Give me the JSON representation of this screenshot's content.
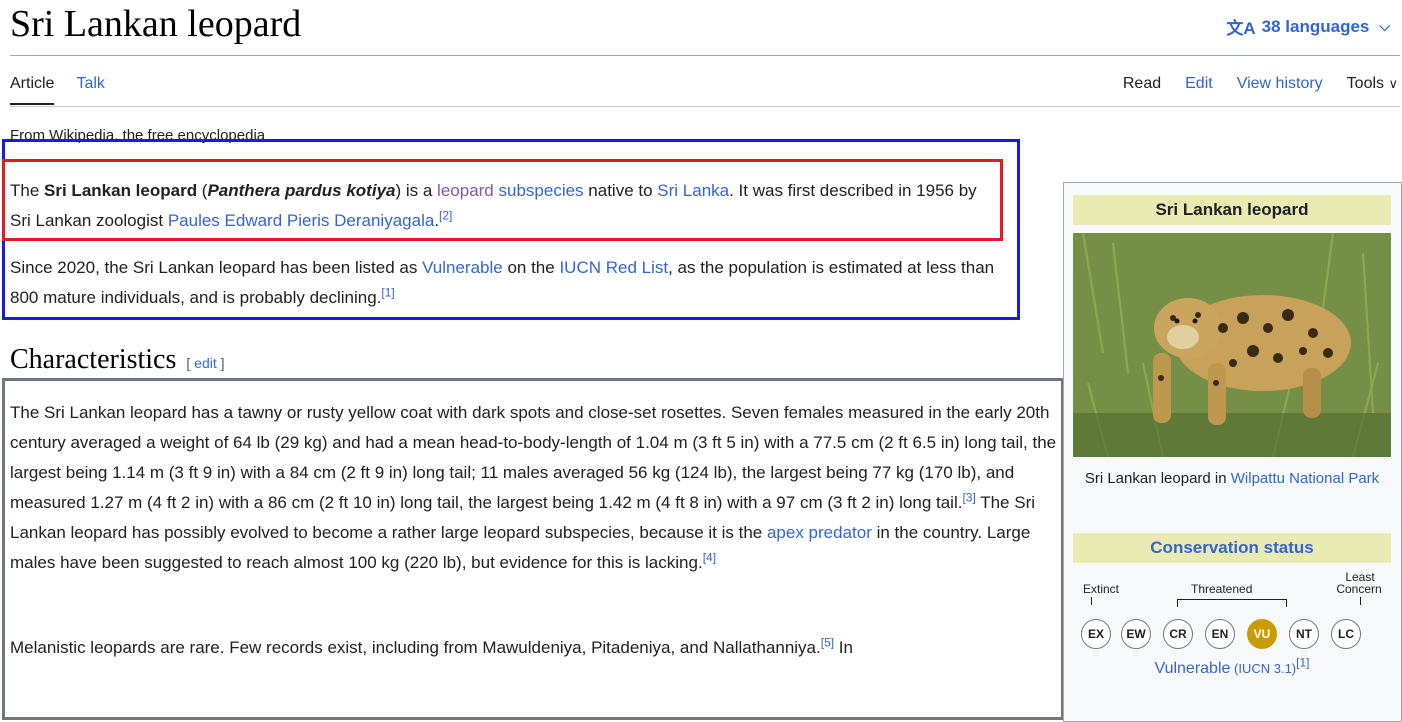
{
  "title": "Sri Lankan leopard",
  "languages": {
    "icon": "translate-icon",
    "label": "38 languages",
    "chevron": "chevron-down-icon"
  },
  "tabs_left": [
    {
      "label": "Article"
    },
    {
      "label": "Talk"
    }
  ],
  "tabs_right": [
    {
      "label": "Read"
    },
    {
      "label": "Edit"
    },
    {
      "label": "View history"
    },
    {
      "label": "Tools"
    }
  ],
  "tagline": "From Wikipedia, the free encyclopedia",
  "intro": {
    "p1": {
      "t1": "The ",
      "name_bold": "Sri Lankan leopard",
      "t2": " (",
      "sci_name": "Panthera pardus kotiya",
      "t3": ") is a ",
      "link_leopard": "leopard",
      "t4": " ",
      "link_subspecies": "subspecies",
      "t5": " native to ",
      "link_srilanka": "Sri Lanka",
      "t6": ". It was first described in 1956 by Sri Lankan zoologist ",
      "link_deraniyagala": "Paules Edward Pieris Deraniyagala",
      "t7": ".",
      "ref": "[2]"
    },
    "p2": {
      "t1": "Since 2020, the Sri Lankan leopard has been listed as ",
      "link_vulnerable": "Vulnerable",
      "t2": " on the ",
      "link_iucn": "IUCN Red List",
      "t3": ", as the population is estimated at less than 800 mature individuals, and is probably declining.",
      "ref": "[1]"
    }
  },
  "characteristics": {
    "heading": "Characteristics",
    "edit_open": "[ ",
    "edit_label": "edit",
    "edit_close": " ]",
    "p1": {
      "t1": "The Sri Lankan leopard has a tawny or rusty yellow coat with dark spots and close-set rosettes. Seven females measured in the early 20th century averaged a weight of 64 lb (29 kg) and had a mean head-to-body-length of 1.04 m (3 ft 5 in) with a 77.5 cm (2 ft 6.5 in) long tail, the largest being 1.14 m (3 ft 9 in) with a 84 cm (2 ft 9 in) long tail; 11 males averaged 56 kg (124 lb), the largest being 77 kg (170 lb), and measured 1.27 m (4 ft 2 in) with a 86 cm (2 ft 10 in) long tail, the largest being 1.42 m (4 ft 8 in) with a 97 cm (3 ft 2 in) long tail.",
      "ref1": "[3]",
      "t2": " The Sri Lankan leopard has possibly evolved to become a rather large leopard subspecies, because it is the ",
      "link_apex": "apex predator",
      "t3": " in the country. Large males have been suggested to reach almost 100 kg (220 lb), but evidence for this is lacking.",
      "ref2": "[4]"
    },
    "p2": {
      "t1": "Melanistic leopards are rare. Few records exist, including from Mawuldeniya, Pitadeniya, and Nallathanniya.",
      "ref": "[5]",
      "t2": " In"
    }
  },
  "infobox": {
    "title": "Sri Lankan leopard",
    "caption_text": "Sri Lankan leopard in ",
    "caption_link": "Wilpattu National Park",
    "conservation_heading": "Conservation status",
    "scale": {
      "extinct": "Extinct",
      "threatened": "Threatened",
      "least_1": "Least",
      "least_2": "Concern",
      "statuses": [
        "EX",
        "EW",
        "CR",
        "EN",
        "VU",
        "NT",
        "LC"
      ],
      "active": "VU",
      "active_color": "#c99b00"
    },
    "status_text": "Vulnerable",
    "status_suffix": " (IUCN 3.1)",
    "status_ref": "[1]"
  },
  "colors": {
    "link": "#3366cc",
    "visited": "#795cb2",
    "infobox_header": "#eaeab3"
  }
}
